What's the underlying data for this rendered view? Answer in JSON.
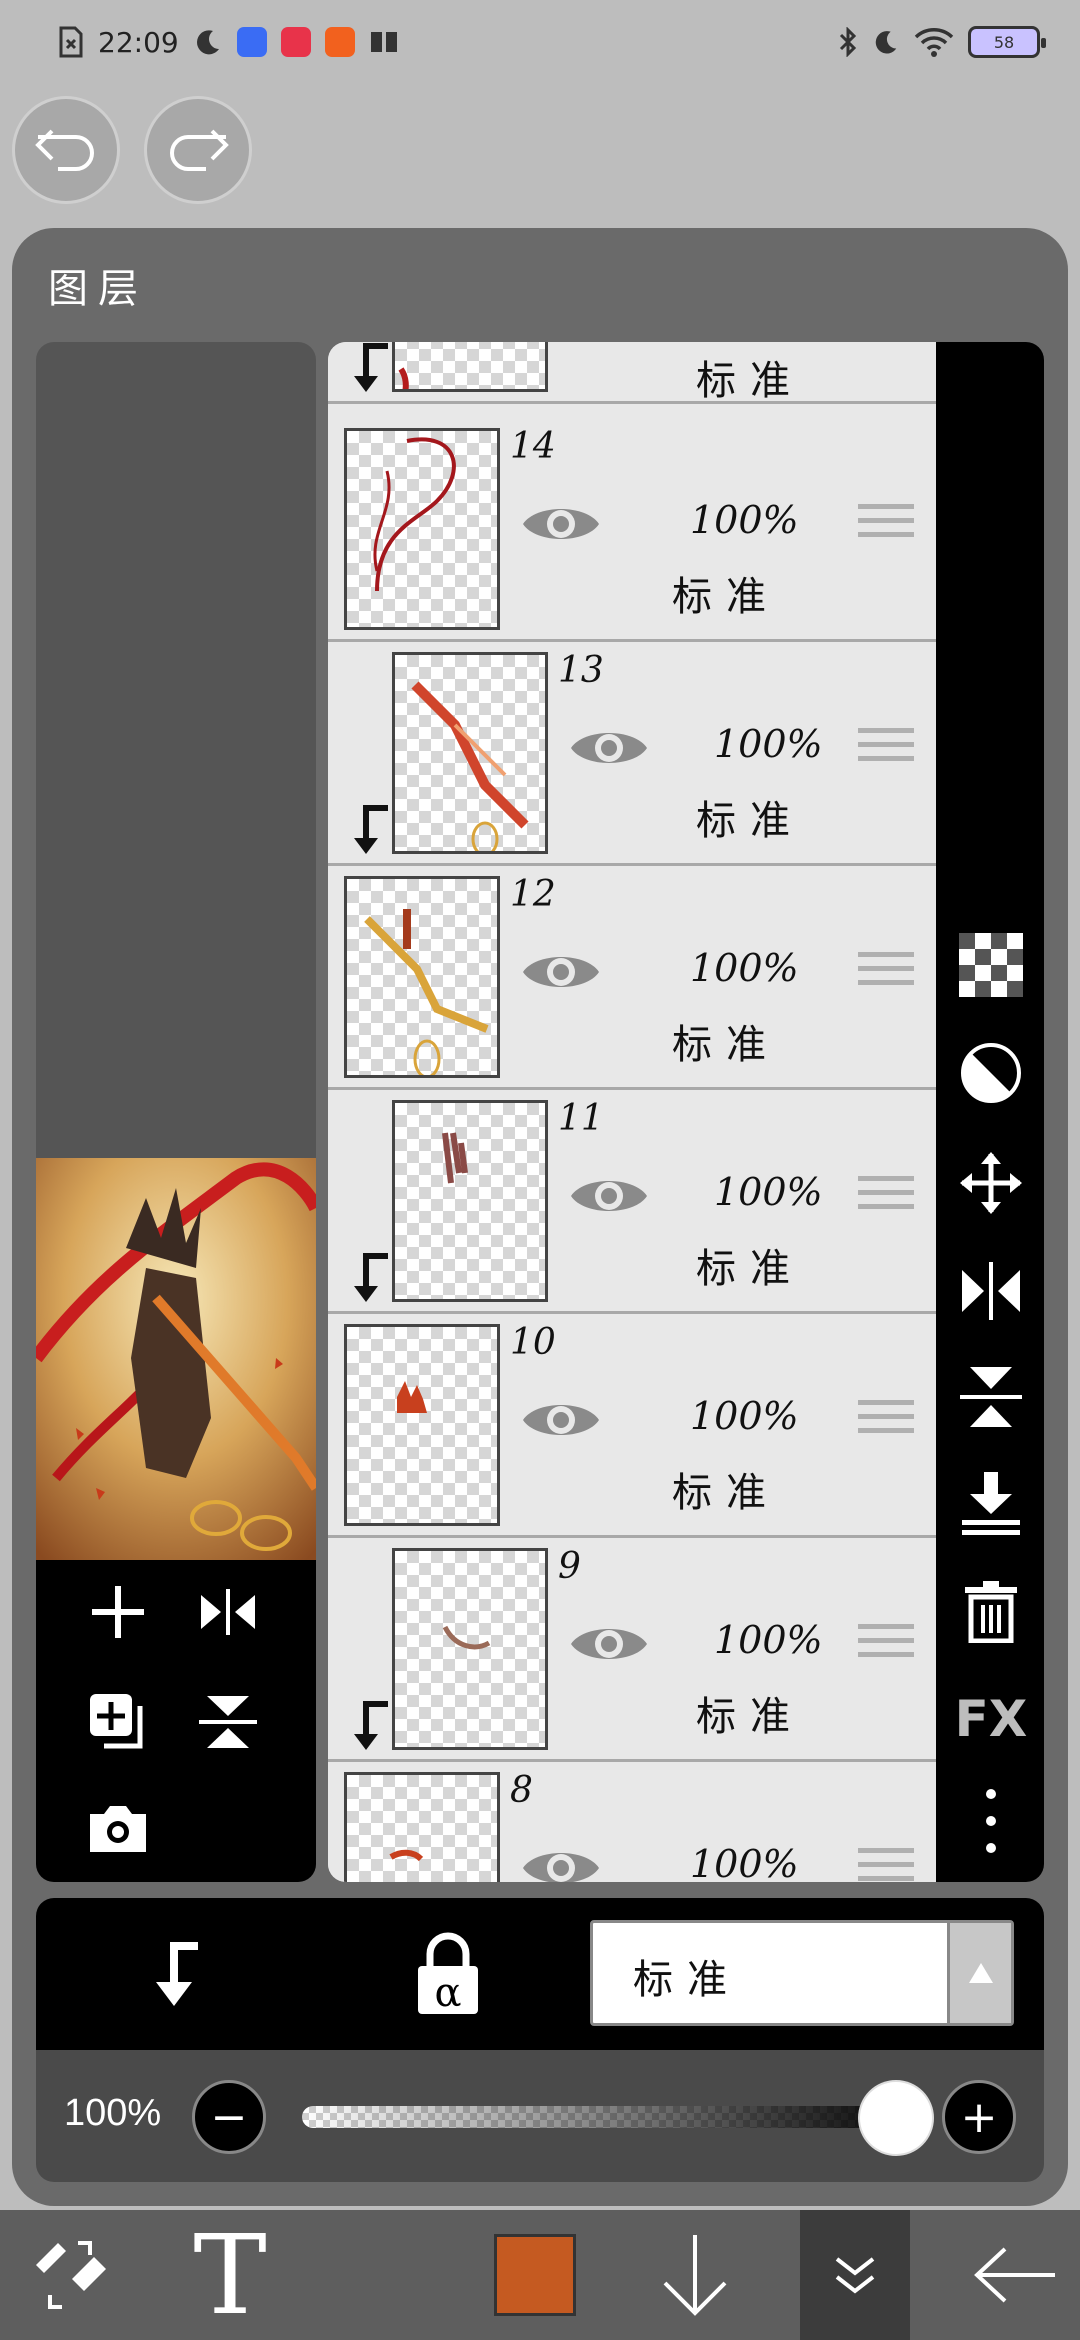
{
  "status_bar": {
    "time": "22:09",
    "battery": "58"
  },
  "panel": {
    "title": "图层"
  },
  "layers": [
    {
      "num": "",
      "opacity": "",
      "blend": "标准",
      "clipped": true,
      "visible": true
    },
    {
      "num": "14",
      "opacity": "100%",
      "blend": "标准",
      "clipped": false,
      "visible": true
    },
    {
      "num": "13",
      "opacity": "100%",
      "blend": "标准",
      "clipped": true,
      "visible": true
    },
    {
      "num": "12",
      "opacity": "100%",
      "blend": "标准",
      "clipped": false,
      "visible": true
    },
    {
      "num": "11",
      "opacity": "100%",
      "blend": "标准",
      "clipped": true,
      "visible": true
    },
    {
      "num": "10",
      "opacity": "100%",
      "blend": "标准",
      "clipped": false,
      "visible": true
    },
    {
      "num": "9",
      "opacity": "100%",
      "blend": "标准",
      "clipped": true,
      "visible": true
    },
    {
      "num": "8",
      "opacity": "100%",
      "blend": "",
      "clipped": false,
      "visible": true
    }
  ],
  "right_tools": [
    "checker-icon",
    "half-circle-icon",
    "move-icon",
    "flip-horizontal-icon",
    "flip-vertical-icon",
    "merge-down-icon",
    "trash-icon",
    "fx-icon",
    "more-icon"
  ],
  "right_tools_fx_label": "FX",
  "blend_mode": {
    "selected": "标准"
  },
  "opacity_control": {
    "value": "100%",
    "level": 1.0,
    "minus": "−",
    "plus": "+"
  },
  "bottom_bar": {
    "text_tool": "T",
    "current_color": "#c55a21"
  },
  "colors": {
    "panel": "#6a6a6a",
    "layer_bg": "#e8e8e8",
    "toolbar": "#000000",
    "accent_color": "#c55a21"
  }
}
